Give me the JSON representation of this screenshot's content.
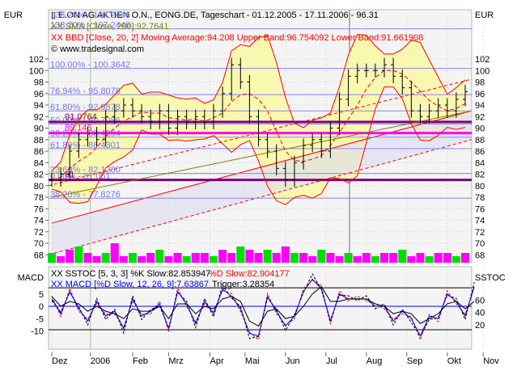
{
  "axis_unit_left": "EUR",
  "axis_unit_right": "EUR",
  "macd_axis_label": "MACD",
  "sstoc_axis_label": "SSTOC",
  "chart_data": [
    {
      "type": "line",
      "title": "E.ON AG AKTIEN O.N., EONG.DE, Tageschart - 01.12.2005 - 17.11.2006 - 96.31",
      "sma_legend": "XX SMA [Close, 200]:92.7641",
      "bbd_legend": "XX BBD [Close, 20, 2] Moving Average:94.208 Upper Band:96.754092 Lower Band:91.661908",
      "copyright": "© www.tradesignal.com",
      "ylim": [
        66,
        105
      ],
      "yticks": [
        68,
        70,
        72,
        74,
        76,
        78,
        80,
        82,
        84,
        86,
        88,
        90,
        92,
        94,
        96,
        98,
        100,
        102
      ],
      "xticks": [
        "Dez",
        "2006",
        "Feb",
        "Mrz",
        "Apr",
        "Mai",
        "Jun",
        "Jul",
        "Aug",
        "Sep",
        "Okt",
        "Nov"
      ],
      "xtick_weeks": [
        0,
        4.3,
        9,
        13,
        17.6,
        21.5,
        26,
        30.5,
        35,
        39.5,
        44,
        48
      ],
      "weekly_close": [
        81,
        82,
        86,
        88,
        89,
        88,
        92,
        93,
        94,
        93,
        92,
        91,
        93,
        90,
        92,
        91,
        92,
        91,
        93,
        96,
        101,
        98,
        92,
        88,
        86,
        83,
        81,
        84,
        87,
        88,
        86,
        90,
        95,
        99,
        100,
        100,
        100,
        101,
        99,
        97,
        93,
        92,
        93,
        94,
        93,
        95,
        96.31
      ],
      "weekly_volume": [
        3,
        2,
        4,
        5,
        3,
        2,
        3,
        6,
        2,
        3,
        2,
        3,
        4,
        2,
        3,
        2,
        3,
        3,
        2,
        4,
        3,
        5,
        4,
        3,
        4,
        3,
        5,
        3,
        3,
        2,
        4,
        3,
        2,
        3,
        2,
        3,
        2,
        3,
        3,
        4,
        2,
        3,
        2,
        3,
        3,
        2,
        3
      ],
      "fib_levels": [
        {
          "label": "138.20% - 107.2446",
          "value": 107.2446
        },
        {
          "label": "100.00% - 100.3642",
          "value": 100.3642
        },
        {
          "label": "76.94% - 95.8078",
          "value": 95.8078
        },
        {
          "label": "61.80% - 92.9878",
          "value": 92.9878
        },
        {
          "label": "50.00% - 90.7086",
          "value": 90.7086
        },
        {
          "label": "38.20% - 88.4294",
          "value": 88.4294
        },
        {
          "label": "61.80% - 86.4301",
          "value": 86.4301
        },
        {
          "label": "23.60% - 82.1280",
          "value": 82.128
        },
        {
          "label": "0.00% - 81.051",
          "value": 81.051
        },
        {
          "label": "38.20% - 77.8276",
          "value": 77.8276
        }
      ],
      "marked_levels": [
        {
          "label": "91.0764",
          "value": 91.0764,
          "color": "#800080"
        },
        {
          "label": "89.145",
          "value": 89.145,
          "color": "#ff00ff"
        },
        {
          "label": "81",
          "value": 81,
          "color": "#800080"
        }
      ]
    },
    {
      "type": "line",
      "sstoc_legend": "XX SSTOC [5, 3, 3] %K Slow:82.853947",
      "sstoc_d_legend": "%D Slow:82.904177",
      "macd_legend": "XX MACD [%D Slow, 12, 26, 9]:7.63867",
      "trigger_legend": "Trigger:3.28354",
      "macd_yticks": [
        5,
        0,
        -5,
        -10
      ],
      "sstoc_yticks": [
        60,
        40,
        20
      ],
      "macd_weekly": [
        3,
        -3,
        6,
        -1,
        -6,
        2,
        -4,
        -2,
        -9,
        3,
        -4,
        -2,
        1,
        -9,
        6,
        1,
        -7,
        2,
        -3,
        7,
        4,
        -1,
        -11,
        -12,
        4,
        -2,
        -8,
        -4,
        6,
        11,
        7,
        -6,
        5,
        3,
        3,
        3,
        0,
        0,
        -6,
        -2,
        -5,
        -12,
        -4,
        -5,
        5,
        2,
        -4,
        8
      ],
      "trigger_weekly": [
        4,
        0,
        2,
        1,
        -2,
        0,
        -2,
        -3,
        -5,
        -1,
        -2,
        -2,
        0,
        -5,
        1,
        1,
        -3,
        0,
        -1,
        3,
        4,
        2,
        -6,
        -8,
        -2,
        -1,
        -5,
        -4,
        0,
        5,
        8,
        2,
        2,
        3,
        3,
        3,
        1,
        0,
        -3,
        -2,
        -3,
        -7,
        -5,
        -3,
        1,
        2,
        -1,
        2
      ]
    }
  ]
}
